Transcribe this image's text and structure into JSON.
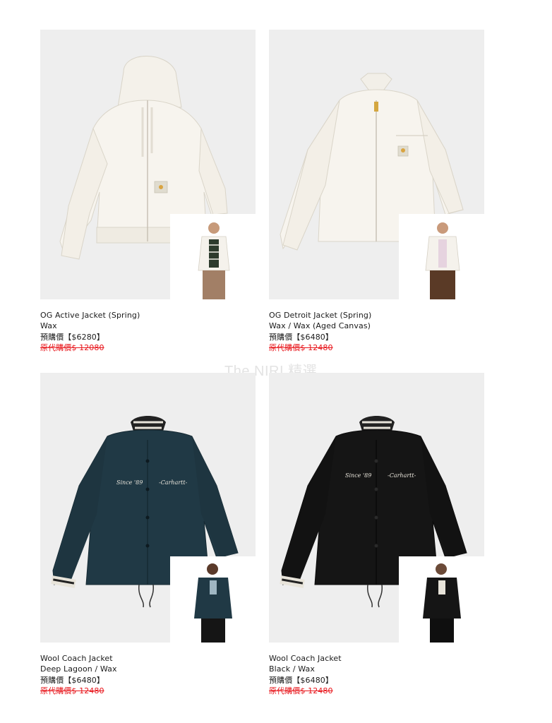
{
  "watermark": "The NIRI 精選",
  "colors": {
    "image_bg": "#eeeeee",
    "original_price_red": "#e8141a",
    "text": "#1a1a1a"
  },
  "products": [
    {
      "name": "OG Active Jacket (Spring)",
      "color": "Wax",
      "preorder_price": "預購價【$6280】",
      "original_price": "原代購價$ 12080"
    },
    {
      "name": "OG Detroit Jacket (Spring)",
      "color": "Wax / Wax (Aged Canvas)",
      "preorder_price": "預購價【$6480】",
      "original_price": "原代購價$ 12480"
    },
    {
      "name": "Wool Coach Jacket",
      "color": "Deep Lagoon / Wax",
      "preorder_price": "預購價【$6480】",
      "original_price": "原代購價$ 12480",
      "logo_text_left": "Since '89",
      "logo_text_right": "-Carhartt-"
    },
    {
      "name": "Wool Coach Jacket",
      "color": "Black / Wax",
      "preorder_price": "預購價【$6480】",
      "original_price": "原代購價$ 12480",
      "logo_text_left": "Since '89",
      "logo_text_right": "-Carhartt-"
    }
  ]
}
